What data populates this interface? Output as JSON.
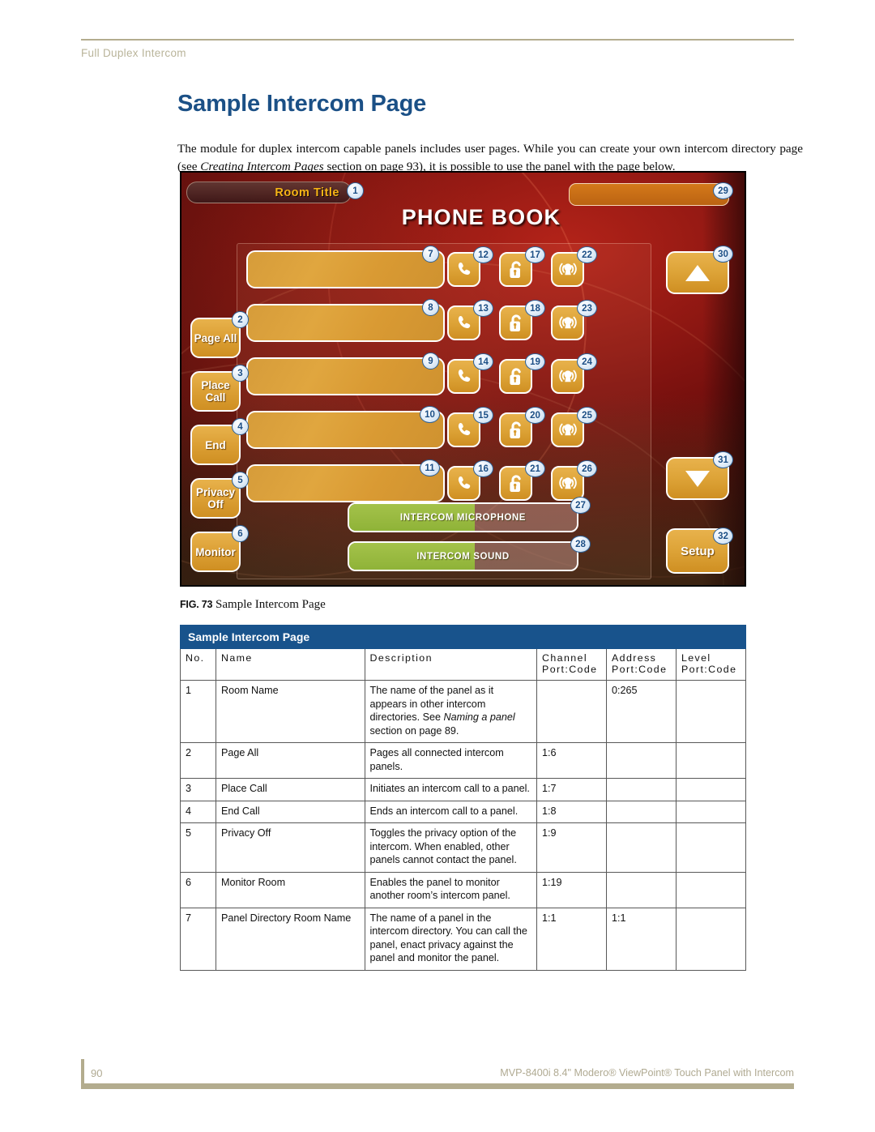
{
  "header": {
    "running_head": "Full Duplex Intercom"
  },
  "page": {
    "title": "Sample Intercom Page",
    "intro_part1": "The module for duplex intercom capable panels includes user pages. While you can create your own intercom directory page (see ",
    "intro_italic": "Creating Intercom Pages",
    "intro_part2": " section on page 93), it is possible to use the panel with the page below."
  },
  "figure": {
    "label": "FIG. 73",
    "caption": "Sample Intercom Page",
    "panel": {
      "room_title": "Room Title",
      "page_heading": "PHONE BOOK",
      "left_buttons": [
        {
          "label": "Page All",
          "callout": "2"
        },
        {
          "label": "Place Call",
          "callout": "3"
        },
        {
          "label": "End",
          "callout": "4"
        },
        {
          "label": "Privacy Off",
          "callout": "5"
        },
        {
          "label": "Monitor",
          "callout": "6"
        }
      ],
      "directory_slots": [
        {
          "callout": "7"
        },
        {
          "callout": "8"
        },
        {
          "callout": "9"
        },
        {
          "callout": "10"
        },
        {
          "callout": "11"
        }
      ],
      "call_icons": [
        "12",
        "13",
        "14",
        "15",
        "16"
      ],
      "privacy_icons": [
        "17",
        "18",
        "19",
        "20",
        "21"
      ],
      "monitor_icons": [
        "22",
        "23",
        "24",
        "25",
        "26"
      ],
      "level_bars": [
        {
          "label": "INTERCOM MICROPHONE",
          "callout": "27",
          "fill_percent": 55
        },
        {
          "label": "INTERCOM SOUND",
          "callout": "28",
          "fill_percent": 55
        }
      ],
      "status_bar_callout": "29",
      "scroll_up_callout": "30",
      "scroll_down_callout": "31",
      "setup_button": {
        "label": "Setup",
        "callout": "32"
      },
      "room_title_callout": "1",
      "colors": {
        "button_fill": "#dda337",
        "button_border": "#ffffff",
        "level_fill": "#9bbb43",
        "status_bar": "#c96d16",
        "callout_text": "#1c4f86",
        "title_gold": "#f6b416"
      }
    }
  },
  "table": {
    "title": "Sample Intercom Page",
    "columns": [
      {
        "head": "No.",
        "sub": ""
      },
      {
        "head": "Name",
        "sub": ""
      },
      {
        "head": "Description",
        "sub": ""
      },
      {
        "head": "Channel",
        "sub": "Port:Code"
      },
      {
        "head": "Address",
        "sub": "Port:Code"
      },
      {
        "head": "Level",
        "sub": "Port:Code"
      }
    ],
    "rows": [
      {
        "no": "1",
        "name": "Room Name",
        "desc_pre": "The name of the panel as it appears in other intercom directories. See ",
        "desc_italic": "Naming a panel",
        "desc_post": " section on page 89.",
        "channel": "",
        "address": "0:265",
        "level": ""
      },
      {
        "no": "2",
        "name": "Page All",
        "desc_pre": "Pages all connected intercom panels.",
        "desc_italic": "",
        "desc_post": "",
        "channel": "1:6",
        "address": "",
        "level": ""
      },
      {
        "no": "3",
        "name": "Place Call",
        "desc_pre": "Initiates an intercom call to a panel.",
        "desc_italic": "",
        "desc_post": "",
        "channel": "1:7",
        "address": "",
        "level": ""
      },
      {
        "no": "4",
        "name": "End Call",
        "desc_pre": "Ends an intercom call to a panel.",
        "desc_italic": "",
        "desc_post": "",
        "channel": "1:8",
        "address": "",
        "level": ""
      },
      {
        "no": "5",
        "name": "Privacy Off",
        "desc_pre": "Toggles the privacy option of the intercom. When enabled, other panels cannot contact the panel.",
        "desc_italic": "",
        "desc_post": "",
        "channel": "1:9",
        "address": "",
        "level": ""
      },
      {
        "no": "6",
        "name": "Monitor Room",
        "desc_pre": "Enables the panel to monitor another room’s intercom panel.",
        "desc_italic": "",
        "desc_post": "",
        "channel": "1:19",
        "address": "",
        "level": ""
      },
      {
        "no": "7",
        "name": "Panel Directory Room Name",
        "desc_pre": "The name of a panel in the intercom directory. You can call the panel, enact privacy against the panel and monitor the panel.",
        "desc_italic": "",
        "desc_post": "",
        "channel": "1:1",
        "address": "1:1",
        "level": ""
      }
    ]
  },
  "footer": {
    "page_number": "90",
    "document": "MVP-8400i 8.4\" Modero® ViewPoint® Touch Panel with Intercom"
  }
}
